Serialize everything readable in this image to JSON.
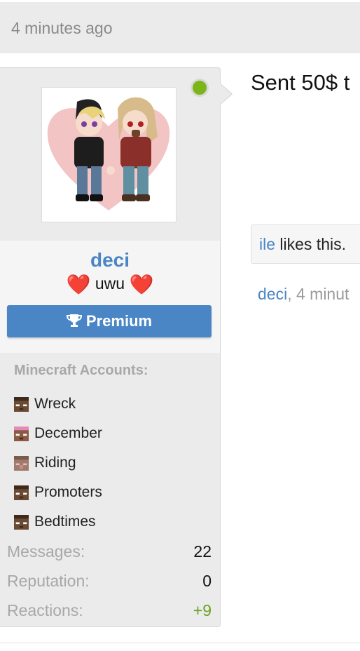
{
  "post": {
    "timestamp": "4 minutes ago",
    "message": "Sent 50$ t",
    "likes": {
      "user": "ile",
      "text": " likes this."
    },
    "meta": {
      "author": "deci",
      "time": ", 4 minut"
    }
  },
  "user": {
    "name": "deci",
    "title_text": " uwu ",
    "title_heart": "❤️",
    "badge_label": "Premium",
    "badge_icon": "trophy-icon",
    "online_status": "online",
    "minecraft_title": "Minecraft Accounts:",
    "minecraft_accounts": [
      {
        "name": "Wreck"
      },
      {
        "name": "December"
      },
      {
        "name": "Riding"
      },
      {
        "name": "Promoters"
      },
      {
        "name": "Bedtimes"
      }
    ],
    "stats": [
      {
        "label": "Messages:",
        "value": "22"
      },
      {
        "label": "Reputation:",
        "value": "0"
      },
      {
        "label": "Reactions:",
        "value": "+9"
      }
    ]
  },
  "colors": {
    "link": "#4a86c6",
    "online": "#7cb518",
    "positive": "#6aa11e",
    "badge": "#4a86c6"
  }
}
